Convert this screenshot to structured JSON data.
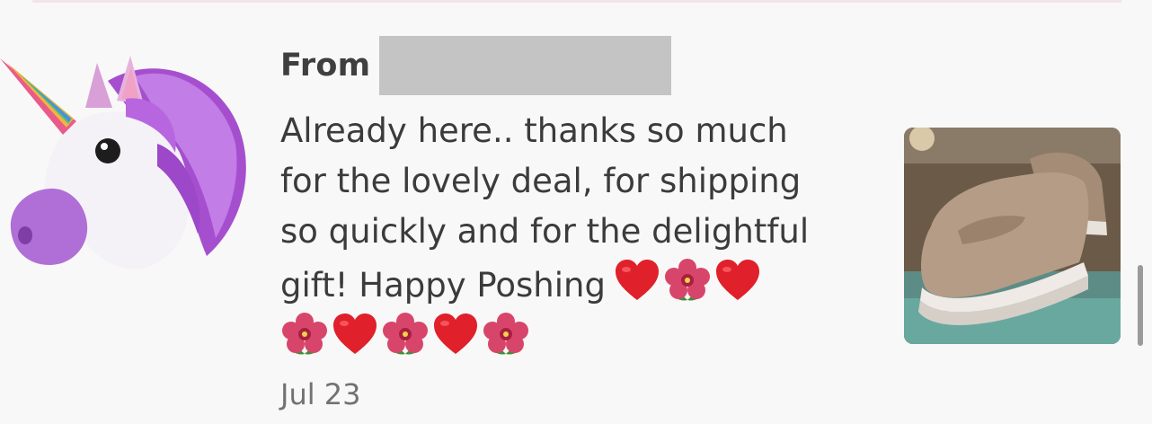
{
  "feedback": {
    "from_label": "From",
    "message_lines": [
      "Already here.. thanks so much",
      "for the lovely deal, for shipping",
      "so quickly and for the delightful",
      "gift! Happy Poshing"
    ],
    "inline_emojis": [
      "heart-emoji",
      "hibiscus-emoji",
      "heart-emoji"
    ],
    "trailing_emojis": [
      "hibiscus-emoji",
      "heart-emoji",
      "hibiscus-emoji",
      "heart-emoji",
      "hibiscus-emoji"
    ],
    "date": "Jul 23"
  },
  "avatar": {
    "icon": "unicorn-avatar-icon"
  },
  "product": {
    "icon": "loafer-shoe-photo"
  },
  "colors": {
    "background": "#f9f8f8",
    "text": "#3b3b3b",
    "date_text": "#727272",
    "redaction": "#c4c4c4",
    "heart": "#e0202a",
    "hibiscus": "#d8456a"
  }
}
